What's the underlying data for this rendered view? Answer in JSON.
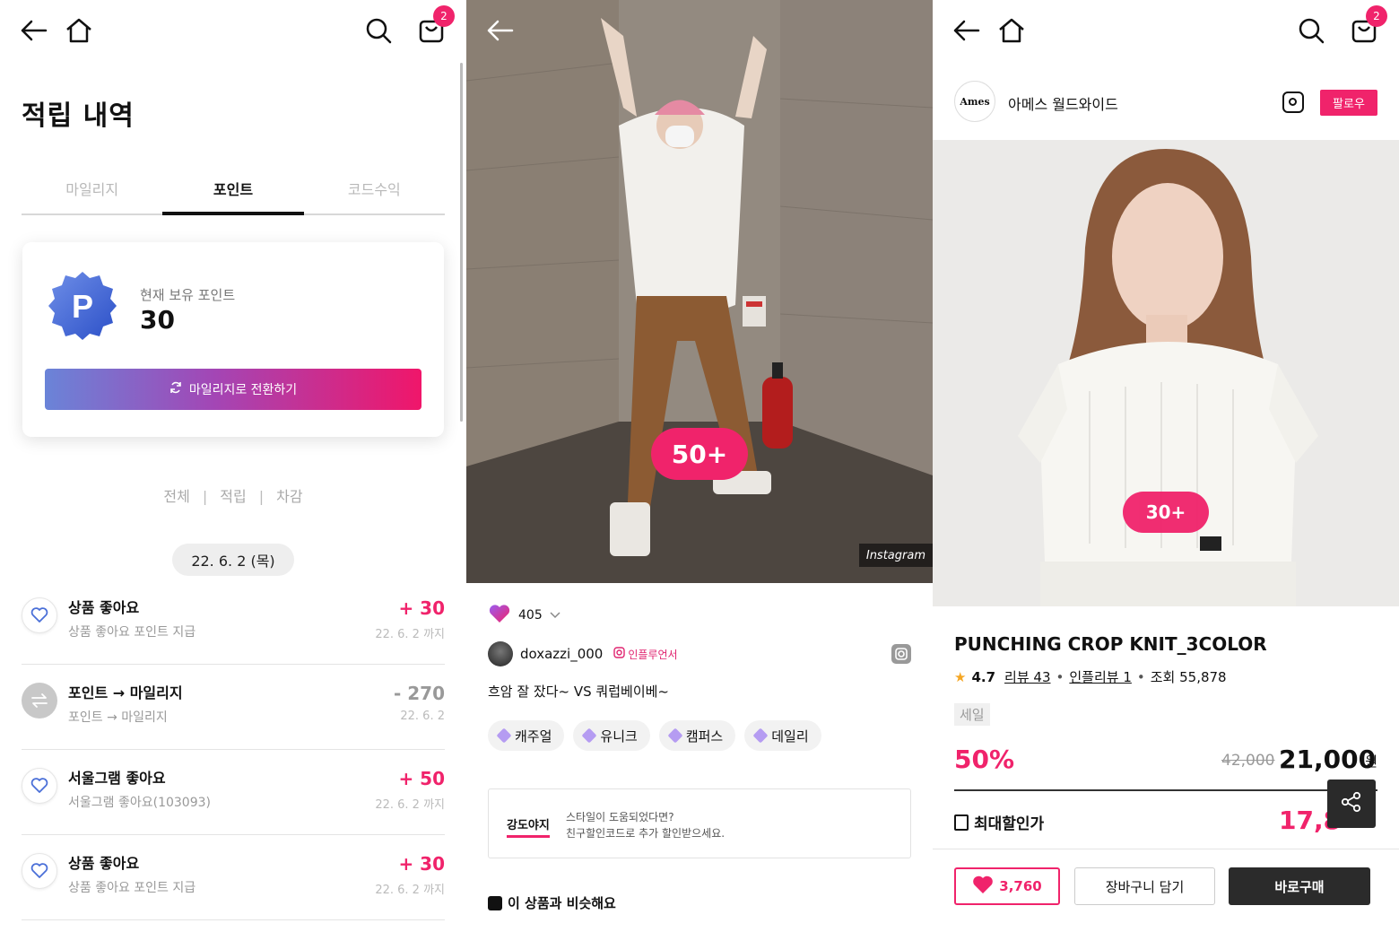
{
  "colors": {
    "accent": "#f0236b",
    "tab_active": "#111111",
    "gradient_start": "#6a84d8"
  },
  "left_screen": {
    "cart_count": "2",
    "title": "적립 내역",
    "tabs": [
      {
        "label": "마일리지",
        "active": false
      },
      {
        "label": "포인트",
        "active": true
      },
      {
        "label": "코드수익",
        "active": false
      }
    ],
    "card": {
      "badge_letter": "P",
      "label": "현재 보유 포인트",
      "value": "30",
      "convert_button": "마일리지로 전환하기"
    },
    "filters": [
      "전체",
      "적립",
      "차감"
    ],
    "filter_separator": "|",
    "date": "22. 6. 2 (목)",
    "history": [
      {
        "icon": "heart-icon",
        "title": "상품 좋아요",
        "sub": "상품 좋아요 포인트 지급",
        "amount": "+ 30",
        "expiry": "22. 6. 2 까지",
        "type": "plus"
      },
      {
        "icon": "swap-icon",
        "title": "포인트 → 마일리지",
        "sub": "포인트 → 마일리지",
        "amount": "- 270",
        "expiry": "22. 6. 2",
        "type": "minus"
      },
      {
        "icon": "heart-icon",
        "title": "서울그램 좋아요",
        "sub": "서울그램 좋아요(103093)",
        "amount": "+ 50",
        "expiry": "22. 6. 2 까지",
        "type": "plus"
      },
      {
        "icon": "heart-icon",
        "title": "상품 좋아요",
        "sub": "상품 좋아요 포인트 지급",
        "amount": "+ 30",
        "expiry": "22. 6. 2 까지",
        "type": "plus"
      }
    ]
  },
  "middle_screen": {
    "photo_count": "50+",
    "photo_source": "Instagram",
    "likes": "405",
    "author": "doxazzi_000",
    "influencer_label": "인플루언서",
    "caption": "흐암 잘 잤다~ VS 쿼럽베이베~",
    "tags": [
      "캐주얼",
      "유니크",
      "캠퍼스",
      "데일리"
    ],
    "promo": {
      "code": "강도야지",
      "line1": "스타일이 도움되었다면?",
      "line2": "친구할인코드로 추가 할인받으세요."
    },
    "similar_heading": "이 상품과 비슷해요"
  },
  "right_screen": {
    "cart_count": "2",
    "brand_logo_text": "Ames",
    "brand_name": "아메스 월드와이드",
    "follow_label": "팔로우",
    "photo_count": "30+",
    "product_name": "PUNCHING CROP KNIT_3COLOR",
    "rating": "4.7",
    "reviews": "리뷰 43",
    "influencer_reviews": "인플리뷰 1",
    "views": "조회 55,878",
    "sale_tag": "세일",
    "discount": "50%",
    "original_price": "42,000",
    "price": "21,000",
    "currency": "원",
    "max_discount_label": "최대할인가",
    "max_discount_price": "17,8",
    "like_count": "3,760",
    "cart_button": "장바구니 담기",
    "buy_button": "바로구매"
  }
}
